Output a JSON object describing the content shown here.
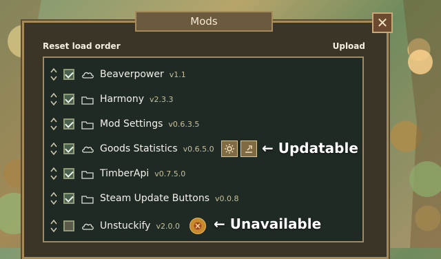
{
  "window": {
    "title": "Mods",
    "close_symbol": "✕"
  },
  "header": {
    "left_action": "Reset load order",
    "right_action": "Upload"
  },
  "mods": [
    {
      "name": "Beaverpower",
      "version": "v1.1",
      "checked": true,
      "source_icon": "cloud-icon"
    },
    {
      "name": "Harmony",
      "version": "v2.3.3",
      "checked": true,
      "source_icon": "folder-icon"
    },
    {
      "name": "Mod Settings",
      "version": "v0.6.3.5",
      "checked": true,
      "source_icon": "folder-icon"
    },
    {
      "name": "Goods Statistics",
      "version": "v0.6.5.0",
      "checked": true,
      "source_icon": "cloud-icon",
      "actions": [
        "gear-icon",
        "update-icon"
      ]
    },
    {
      "name": "TimberApi",
      "version": "v0.7.5.0",
      "checked": true,
      "source_icon": "folder-icon"
    },
    {
      "name": "Steam Update Buttons",
      "version": "v0.0.8",
      "checked": true,
      "source_icon": "folder-icon"
    },
    {
      "name": "Unstuckify",
      "version": "v2.0.0",
      "checked": false,
      "source_icon": "cloud-icon",
      "status_icon": "unavailable-icon"
    }
  ],
  "annotations": {
    "updatable": "← Updatable",
    "unavailable": "← Unavailable"
  },
  "colors": {
    "panel_bg": "#3a3526",
    "list_bg": "#1f2a24",
    "accent": "#a58a5a",
    "text": "#f3f2ea",
    "version": "#c6c19c",
    "checkbox_checked": "#49604c",
    "unavailable_badge": "#c98a2c"
  }
}
